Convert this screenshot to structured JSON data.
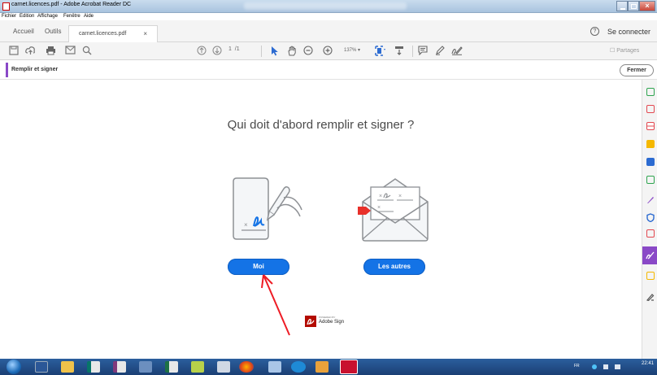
{
  "window": {
    "title": "carnet.licences.pdf - Adobe Acrobat Reader DC",
    "controls": [
      "minimize",
      "maximize",
      "close"
    ]
  },
  "menubar": {
    "items": [
      "Fichier",
      "Edition",
      "Affichage",
      "Fenêtre",
      "Aide"
    ]
  },
  "tabs": {
    "home": "Accueil",
    "tools": "Outils",
    "document": "carnet.licences.pdf",
    "close_symbol": "×",
    "help_symbol": "?",
    "connect": "Se connecter"
  },
  "toolbar": {
    "icons": [
      "save-icon",
      "upload-icon",
      "print-icon",
      "email-icon",
      "search-icon",
      "prev-page-icon",
      "next-page-icon",
      "select-cursor-icon",
      "hand-icon",
      "zoom-out-icon",
      "zoom-in-icon",
      "fit-page-icon",
      "scroll-mode-icon",
      "comment-icon",
      "pen-icon",
      "sign-icon"
    ],
    "page_current": "1",
    "page_total": "/1",
    "zoom": "137%",
    "share": "Partages"
  },
  "fill_sign": {
    "label": "Remplir et signer",
    "close_button": "Fermer",
    "accent_color": "#8a49c7"
  },
  "main": {
    "heading": "Qui doit d'abord remplir et signer ?",
    "option_me": "Moi",
    "option_others": "Les autres",
    "button_color": "#1473e6",
    "powered_by": "POWERED BY",
    "brand": "Adobe Sign"
  },
  "right_panel": {
    "tools": [
      "create-pdf-icon",
      "edit-pdf-icon",
      "organize-pages-icon",
      "comment-icon",
      "combine-files-icon",
      "export-pdf-icon",
      "fill-sign-icon",
      "protect-icon",
      "send-for-signature-icon",
      "fill-sign-active-icon",
      "send-track-icon",
      "more-tools-icon"
    ]
  },
  "taskbar": {
    "apps": [
      "start-orb",
      "word-icon",
      "folder-icon",
      "publisher-icon",
      "onenote-icon",
      "paint-icon",
      "excel-icon",
      "snipping-icon",
      "image-viewer-icon",
      "firefox-icon",
      "app-icon",
      "ie-icon",
      "outlook-icon",
      "acrobat-icon"
    ],
    "language": "FR",
    "time": "22:41"
  }
}
